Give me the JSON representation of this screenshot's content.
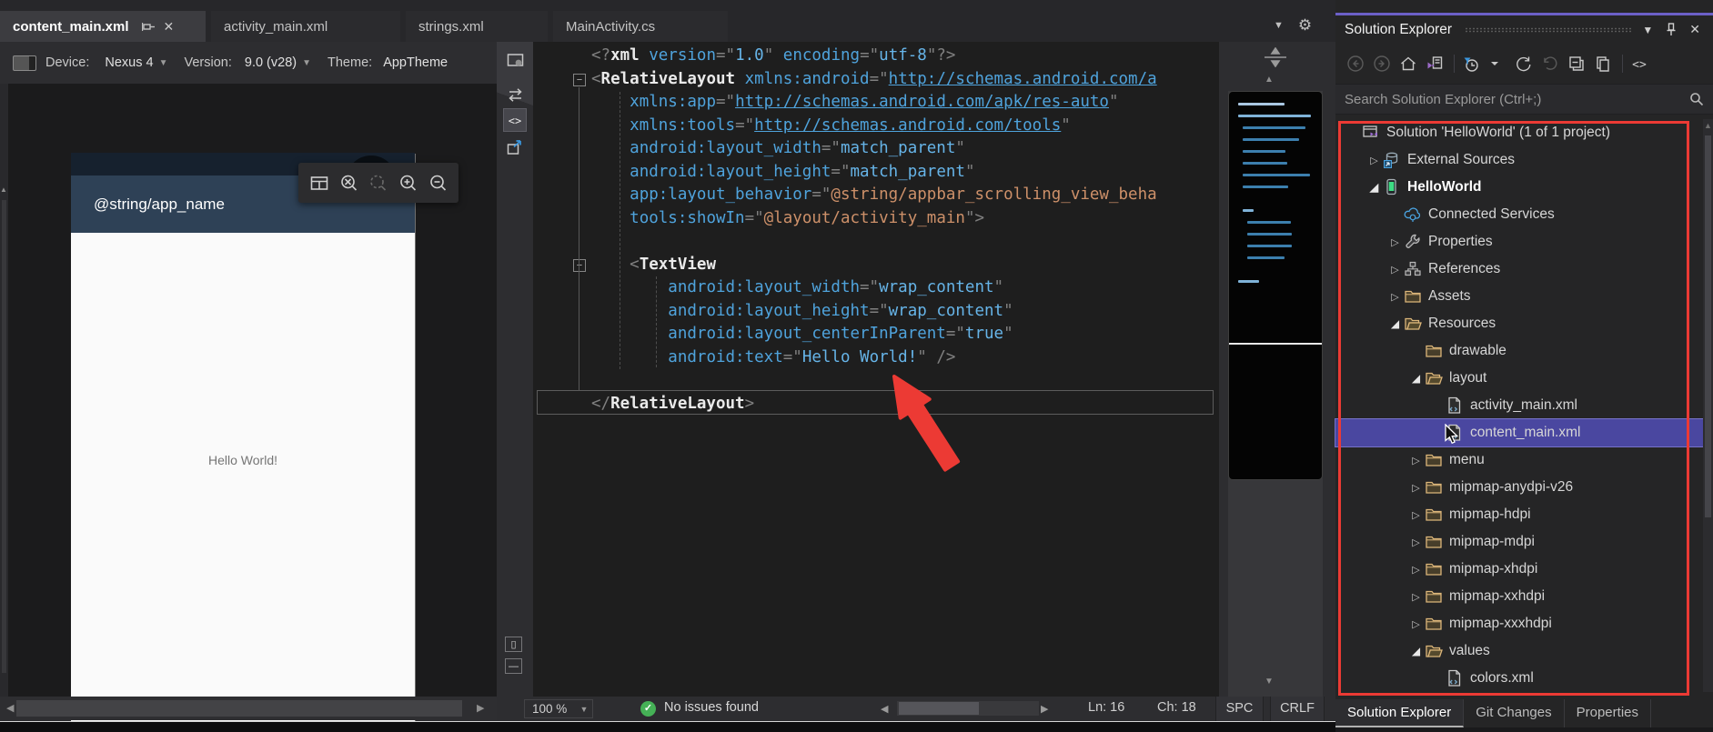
{
  "window": {
    "tabs": [
      {
        "label": "content_main.xml",
        "active": true,
        "pinned": true
      },
      {
        "label": "activity_main.xml",
        "active": false
      },
      {
        "label": "strings.xml",
        "active": false
      },
      {
        "label": "MainActivity.cs",
        "active": false
      }
    ],
    "editor_well_icons": [
      "dropdown-chevron",
      "gear"
    ]
  },
  "designer": {
    "toolbar": {
      "device_label": "Device:",
      "device_value": "Nexus 4",
      "version_label": "Version:",
      "version_value": "9.0 (v28)",
      "theme_label": "Theme:",
      "theme_value": "AppTheme"
    },
    "phone": {
      "appbar_text": "@string/app_name",
      "body_text": "Hello World!"
    },
    "float_toolbar_icons": [
      "split-view",
      "zoom-to-fit",
      "zoom-to-selection",
      "zoom-in",
      "zoom-out"
    ]
  },
  "splitter_icons": [
    "designer-view",
    "swap-panes",
    "source-view",
    "open-in-new-window"
  ],
  "splitter_bottom_icons": [
    "vertical-split",
    "horizontal-split",
    "collapse-pane"
  ],
  "editor": {
    "current_line": 16,
    "code_lines": [
      {
        "segs": [
          [
            "d",
            "<?"
          ],
          [
            "e",
            "xml"
          ],
          [
            "n",
            " "
          ],
          [
            "a",
            "version"
          ],
          [
            "d",
            "=\""
          ],
          [
            "v",
            "1.0"
          ],
          [
            "d",
            "\""
          ],
          [
            "n",
            " "
          ],
          [
            "a",
            "encoding"
          ],
          [
            "d",
            "=\""
          ],
          [
            "v",
            "utf-8"
          ],
          [
            "d",
            "\"?>"
          ]
        ]
      },
      {
        "segs": [
          [
            "d",
            "<"
          ],
          [
            "e",
            "RelativeLayout"
          ],
          [
            "n",
            " "
          ],
          [
            "a",
            "xmlns:android"
          ],
          [
            "d",
            "=\""
          ],
          [
            "u",
            "http://schemas.android.com/a"
          ]
        ]
      },
      {
        "segs": [
          [
            "n",
            "    "
          ],
          [
            "a",
            "xmlns:app"
          ],
          [
            "d",
            "=\""
          ],
          [
            "u",
            "http://schemas.android.com/apk/res-auto"
          ],
          [
            "d",
            "\""
          ]
        ]
      },
      {
        "segs": [
          [
            "n",
            "    "
          ],
          [
            "a",
            "xmlns:tools"
          ],
          [
            "d",
            "=\""
          ],
          [
            "u",
            "http://schemas.android.com/tools"
          ],
          [
            "d",
            "\""
          ]
        ]
      },
      {
        "segs": [
          [
            "n",
            "    "
          ],
          [
            "a",
            "android:layout_width"
          ],
          [
            "d",
            "=\""
          ],
          [
            "v",
            "match_parent"
          ],
          [
            "d",
            "\""
          ]
        ]
      },
      {
        "segs": [
          [
            "n",
            "    "
          ],
          [
            "a",
            "android:layout_height"
          ],
          [
            "d",
            "=\""
          ],
          [
            "v",
            "match_parent"
          ],
          [
            "d",
            "\""
          ]
        ]
      },
      {
        "segs": [
          [
            "n",
            "    "
          ],
          [
            "a",
            "app:layout_behavior"
          ],
          [
            "d",
            "=\""
          ],
          [
            "o",
            "@string/appbar_scrolling_view_beha"
          ]
        ]
      },
      {
        "segs": [
          [
            "n",
            "    "
          ],
          [
            "a",
            "tools:showIn"
          ],
          [
            "d",
            "=\""
          ],
          [
            "o",
            "@layout/activity_main"
          ],
          [
            "d",
            "\">"
          ]
        ]
      },
      {
        "segs": []
      },
      {
        "segs": [
          [
            "n",
            "    "
          ],
          [
            "d",
            "<"
          ],
          [
            "e",
            "TextView"
          ]
        ]
      },
      {
        "segs": [
          [
            "n",
            "        "
          ],
          [
            "a",
            "android:layout_width"
          ],
          [
            "d",
            "=\""
          ],
          [
            "v",
            "wrap_content"
          ],
          [
            "d",
            "\""
          ]
        ]
      },
      {
        "segs": [
          [
            "n",
            "        "
          ],
          [
            "a",
            "android:layout_height"
          ],
          [
            "d",
            "=\""
          ],
          [
            "v",
            "wrap_content"
          ],
          [
            "d",
            "\""
          ]
        ]
      },
      {
        "segs": [
          [
            "n",
            "        "
          ],
          [
            "a",
            "android:layout_centerInParent"
          ],
          [
            "d",
            "=\""
          ],
          [
            "v",
            "true"
          ],
          [
            "d",
            "\""
          ]
        ]
      },
      {
        "segs": [
          [
            "n",
            "        "
          ],
          [
            "a",
            "android:text"
          ],
          [
            "d",
            "=\""
          ],
          [
            "v",
            "Hello World!"
          ],
          [
            "d",
            "\" />"
          ]
        ]
      },
      {
        "segs": []
      },
      {
        "segs": [
          [
            "d",
            "</"
          ],
          [
            "e",
            "RelativeLayout"
          ],
          [
            "d",
            ">"
          ]
        ]
      }
    ],
    "status": {
      "zoom": "100 %",
      "message": "No issues found",
      "line": "Ln: 16",
      "column": "Ch: 18",
      "spaces": "SPC",
      "line_ending": "CRLF"
    }
  },
  "solution_explorer": {
    "title": "Solution Explorer",
    "title_icons": [
      "dropdown-chevron",
      "pin",
      "close"
    ],
    "toolbar_icons": [
      "back",
      "forward",
      "home",
      "sync-with-active-document",
      "pending-changes-filter",
      "filter-dropdown",
      "refresh",
      "undo",
      "collapse-all",
      "show-all-files",
      "view-code"
    ],
    "search_placeholder": "Search Solution Explorer (Ctrl+;)",
    "tree": [
      {
        "label": "Solution 'HelloWorld' (1 of 1 project)",
        "icon": "solution",
        "level": 0,
        "expander": "none"
      },
      {
        "label": "External Sources",
        "icon": "external-sources",
        "level": 1,
        "expander": "collapsed"
      },
      {
        "label": "HelloWorld",
        "icon": "android-project",
        "level": 1,
        "expander": "expanded",
        "bold": true
      },
      {
        "label": "Connected Services",
        "icon": "connected-services",
        "level": 2,
        "expander": "none"
      },
      {
        "label": "Properties",
        "icon": "properties-wrench",
        "level": 2,
        "expander": "collapsed"
      },
      {
        "label": "References",
        "icon": "references",
        "level": 2,
        "expander": "collapsed"
      },
      {
        "label": "Assets",
        "icon": "folder-closed",
        "level": 2,
        "expander": "collapsed"
      },
      {
        "label": "Resources",
        "icon": "folder-open",
        "level": 2,
        "expander": "expanded"
      },
      {
        "label": "drawable",
        "icon": "folder-closed",
        "level": 3,
        "expander": "none"
      },
      {
        "label": "layout",
        "icon": "folder-open",
        "level": 3,
        "expander": "expanded"
      },
      {
        "label": "activity_main.xml",
        "icon": "xml-file",
        "level": 4,
        "expander": "none"
      },
      {
        "label": "content_main.xml",
        "icon": "xml-file",
        "level": 4,
        "expander": "none",
        "selected": true
      },
      {
        "label": "menu",
        "icon": "folder-closed",
        "level": 3,
        "expander": "collapsed"
      },
      {
        "label": "mipmap-anydpi-v26",
        "icon": "folder-closed",
        "level": 3,
        "expander": "collapsed"
      },
      {
        "label": "mipmap-hdpi",
        "icon": "folder-closed",
        "level": 3,
        "expander": "collapsed"
      },
      {
        "label": "mipmap-mdpi",
        "icon": "folder-closed",
        "level": 3,
        "expander": "collapsed"
      },
      {
        "label": "mipmap-xhdpi",
        "icon": "folder-closed",
        "level": 3,
        "expander": "collapsed"
      },
      {
        "label": "mipmap-xxhdpi",
        "icon": "folder-closed",
        "level": 3,
        "expander": "collapsed"
      },
      {
        "label": "mipmap-xxxhdpi",
        "icon": "folder-closed",
        "level": 3,
        "expander": "collapsed"
      },
      {
        "label": "values",
        "icon": "folder-open",
        "level": 3,
        "expander": "expanded"
      },
      {
        "label": "colors.xml",
        "icon": "xml-file",
        "level": 4,
        "expander": "none"
      }
    ],
    "bottom_tabs": [
      {
        "label": "Solution Explorer",
        "active": true
      },
      {
        "label": "Git Changes",
        "active": false
      },
      {
        "label": "Properties",
        "active": false
      }
    ]
  },
  "colors": {
    "panel_accent_purple": "#6b5fc7",
    "annotation_red": "#ec3a34",
    "selection_purple": "#4a47a0",
    "appbar_navy": "#2e4156",
    "status_navy": "#16212e",
    "issues_green": "#45b156",
    "folder_tan": "#dcb67a",
    "code_attr_blue": "#4fa3dc",
    "code_value_blue": "#66b4e8",
    "code_resource_orange": "#cd9069"
  }
}
